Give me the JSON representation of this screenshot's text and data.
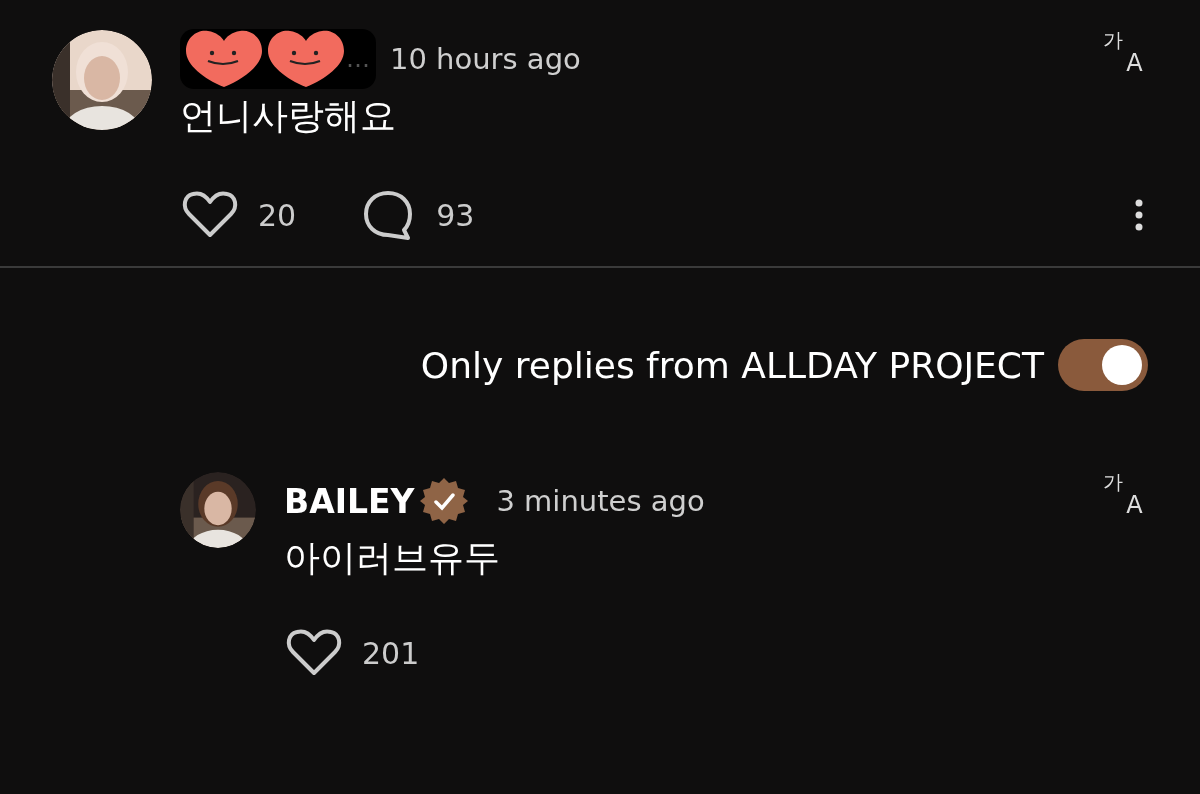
{
  "comment": {
    "author_suffix": "…",
    "time": "10 hours ago",
    "text": "언니사랑해요",
    "translate_glyphs": [
      "가",
      "A"
    ],
    "likes": "20",
    "replies": "93",
    "liked": false
  },
  "filter": {
    "label": "Only replies from ALLDAY PROJECT",
    "on": true
  },
  "reply": {
    "author": "BAILEY",
    "verified": true,
    "time": "3 minutes ago",
    "text": "아이러브유두",
    "translate_glyphs": [
      "가",
      "A"
    ],
    "likes": "201",
    "liked": false
  }
}
